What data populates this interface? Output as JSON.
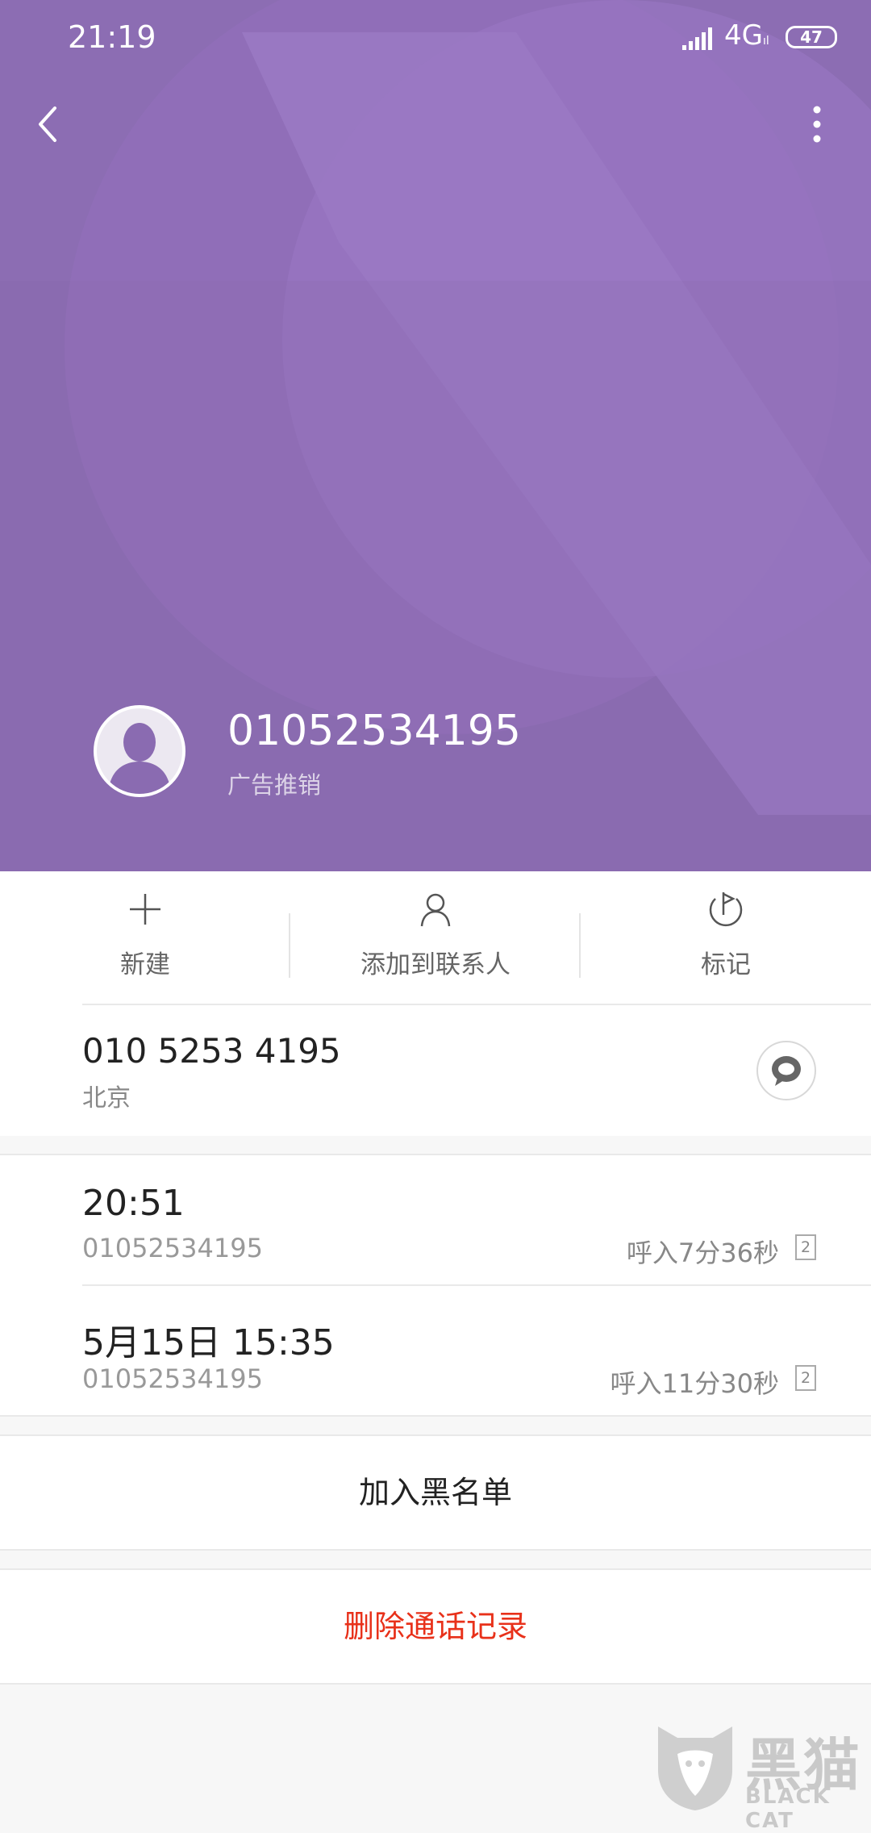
{
  "status_bar": {
    "time": "21:19",
    "network": "4G",
    "network_suffix": "ıl",
    "battery": "47"
  },
  "caller": {
    "number": "01052534195",
    "tag": "广告推销"
  },
  "actions": [
    {
      "label": "新建",
      "icon": "plus-icon"
    },
    {
      "label": "添加到联系人",
      "icon": "person-icon"
    },
    {
      "label": "标记",
      "icon": "flag-icon"
    }
  ],
  "number_info": {
    "formatted_number": "010 5253 4195",
    "location": "北京"
  },
  "call_records": [
    {
      "time": "20:51",
      "number": "01052534195",
      "detail": "呼入7分36秒",
      "sim": "2"
    },
    {
      "time": "5月15日 15:35",
      "number": "01052534195",
      "detail": "呼入11分30秒",
      "sim": "2"
    }
  ],
  "buttons": {
    "blacklist": "加入黑名单",
    "delete_history": "删除通话记录"
  },
  "watermark": {
    "text": "黑猫",
    "subtext": "BLACK CAT"
  },
  "colors": {
    "header_bg": "#8a6bb1",
    "danger": "#e8311a"
  }
}
